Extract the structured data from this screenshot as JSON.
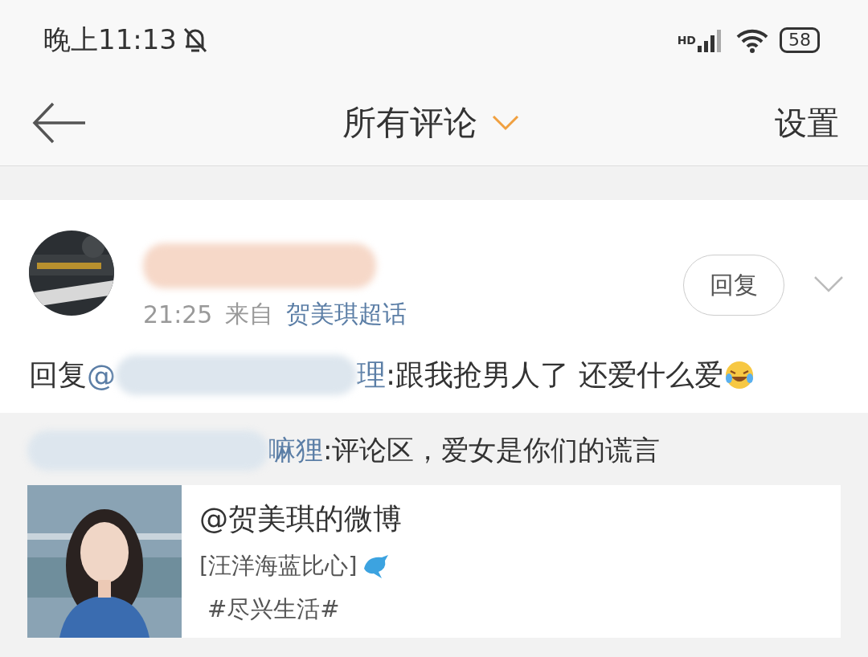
{
  "status_bar": {
    "time": "晚上11:13",
    "network": "HD",
    "battery": "58"
  },
  "nav": {
    "title": "所有评论",
    "action": "设置"
  },
  "comment": {
    "time": "21:25",
    "source_prefix": "来自",
    "source": "贺美琪超话",
    "reply_button": "回复",
    "segments": [
      {
        "kind": "plain",
        "text": "回复"
      },
      {
        "kind": "mention",
        "text": "@"
      },
      {
        "kind": "blur"
      },
      {
        "kind": "mention",
        "text": "理"
      },
      {
        "kind": "plain",
        "text": ":跟我抢男人了 还爱什么爱"
      },
      {
        "kind": "emoji"
      }
    ]
  },
  "quoted": {
    "segments": [
      {
        "kind": "blur"
      },
      {
        "kind": "mention",
        "text": "嘛狸"
      },
      {
        "kind": "plain",
        "text": ":评论区，爱女是你们的谎言"
      }
    ]
  },
  "card": {
    "title": "@贺美琪的微博",
    "line_1": "[汪洋海蓝比心]",
    "line_2": "#尽兴生活#"
  }
}
